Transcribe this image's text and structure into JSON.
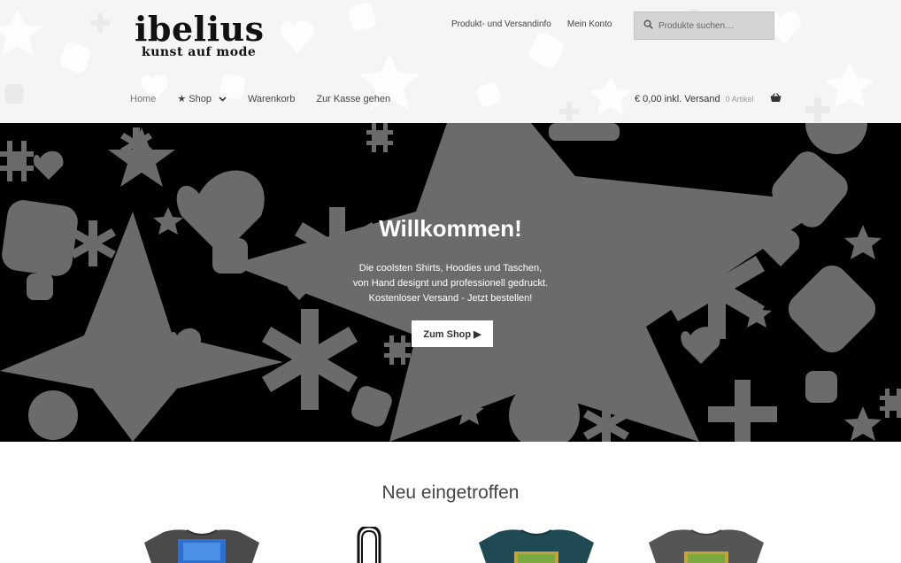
{
  "logo": {
    "line1": "ibelius",
    "line2": "kunst auf mode"
  },
  "secondary_nav": [
    {
      "label": "Produkt- und Versandinfo"
    },
    {
      "label": "Mein Konto"
    }
  ],
  "search": {
    "placeholder": "Produkte suchen…",
    "icon": "search-icon"
  },
  "main_nav": {
    "home": "Home",
    "shop": "★ Shop",
    "cart": "Warenkorb",
    "checkout": "Zur Kasse gehen"
  },
  "cart": {
    "amount": "€ 0,00 inkl. Versand",
    "count": "0 Artikel",
    "icon": "basket-icon"
  },
  "hero": {
    "title": "Willkommen!",
    "text_lines": [
      "Die coolsten Shirts, Hoodies und Taschen,",
      "von Hand designt und professionell gedruckt.",
      "Kostenloser Versand - Jetzt bestellen!"
    ],
    "button": "Zum Shop ▶"
  },
  "new_arrivals": {
    "title": "Neu eingetroffen",
    "products": [
      {
        "type": "tshirt",
        "color": "#4a4a4a",
        "print": "blue"
      },
      {
        "type": "bag",
        "color": "#111111",
        "print": "none"
      },
      {
        "type": "tshirt",
        "color": "#1f4a54",
        "print": "sunshine day"
      },
      {
        "type": "tshirt",
        "color": "#555555",
        "print": "sunshine day"
      }
    ]
  },
  "colors": {
    "hero_bg": "#000000",
    "hero_shapes": "#6b6b6b",
    "header_bg": "#f5f5f5"
  }
}
